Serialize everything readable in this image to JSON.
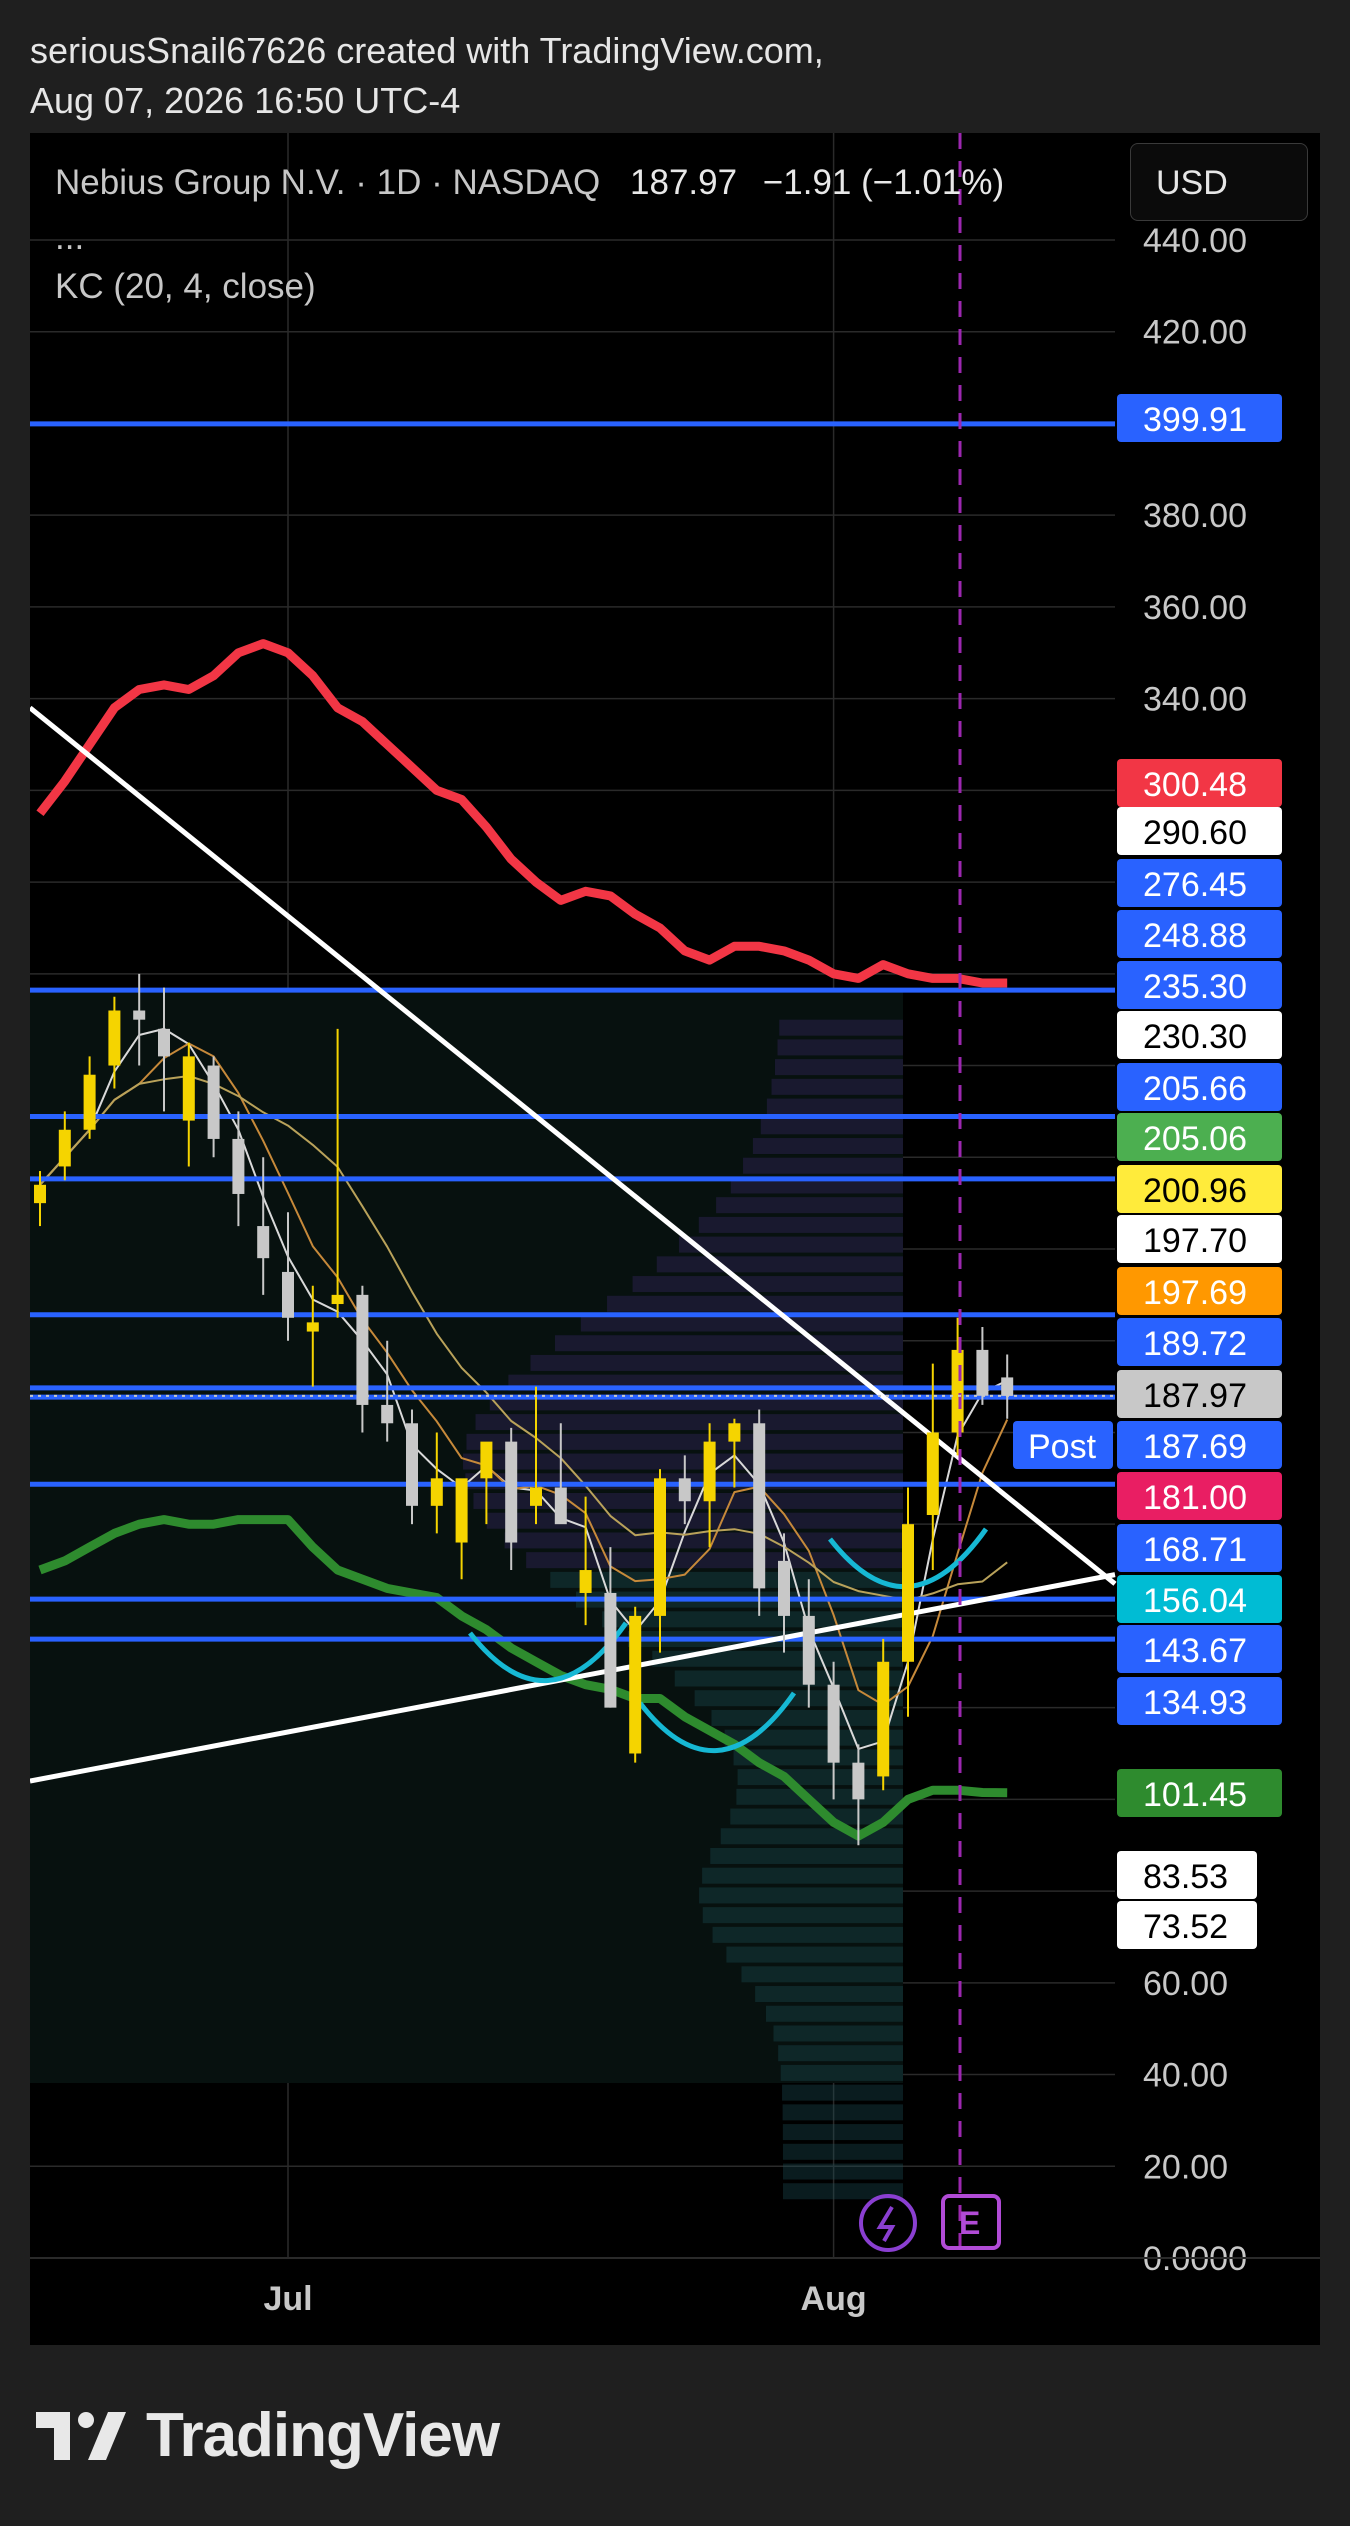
{
  "header": {
    "creator_line": "seriousSnail67626 created with TradingView.com,",
    "date_line": "Aug 07, 2026 16:50 UTC-4"
  },
  "legend": {
    "symbol_line": "Nebius Group N.V. · 1D · NASDAQ",
    "last_price": "187.97",
    "change": "−1.91 (−1.01%)",
    "ellipsis": "...",
    "indicator": "KC (20, 4, close)"
  },
  "currency_button": "USD",
  "event_marker": "E",
  "footer": {
    "brand": "TradingView"
  },
  "colors": {
    "background": "#000000",
    "grid": "#2a2a2a",
    "up_candle": "#f5d400",
    "down_candle": "#c8c8c8",
    "kc_upper": "#f23645",
    "kc_lower": "#2e8b2e",
    "horizontal_line": "#2962ff",
    "trendline": "#ffffff",
    "event_line": "#9c27b0",
    "arc": "#16b8d4"
  },
  "chart_data": {
    "type": "candlestick",
    "y_axis": {
      "min": 0,
      "max": 450,
      "ticks": [
        {
          "value": 440,
          "label": "440.00"
        },
        {
          "value": 420,
          "label": "420.00"
        },
        {
          "value": 380,
          "label": "380.00"
        },
        {
          "value": 360,
          "label": "360.00"
        },
        {
          "value": 340,
          "label": "340.00"
        },
        {
          "value": 60,
          "label": "60.00"
        },
        {
          "value": 40,
          "label": "40.00"
        },
        {
          "value": 20,
          "label": "20.00"
        },
        {
          "value": 0,
          "label": "0.0000"
        }
      ]
    },
    "x_axis": {
      "labels": [
        {
          "label": "Jul",
          "bar_index": 10
        },
        {
          "label": "Aug",
          "bar_index": 32
        }
      ]
    },
    "candles": [
      {
        "o": 230,
        "h": 237,
        "l": 225,
        "c": 234
      },
      {
        "o": 238,
        "h": 250,
        "l": 235,
        "c": 246
      },
      {
        "o": 246,
        "h": 262,
        "l": 244,
        "c": 258
      },
      {
        "o": 260,
        "h": 275,
        "l": 255,
        "c": 272
      },
      {
        "o": 272,
        "h": 280,
        "l": 260,
        "c": 270
      },
      {
        "o": 268,
        "h": 277,
        "l": 250,
        "c": 262
      },
      {
        "o": 248,
        "h": 265,
        "l": 238,
        "c": 262
      },
      {
        "o": 260,
        "h": 262,
        "l": 240,
        "c": 244
      },
      {
        "o": 244,
        "h": 250,
        "l": 225,
        "c": 232
      },
      {
        "o": 225,
        "h": 240,
        "l": 210,
        "c": 218
      },
      {
        "o": 215,
        "h": 228,
        "l": 200,
        "c": 205
      },
      {
        "o": 202,
        "h": 212,
        "l": 190,
        "c": 204
      },
      {
        "o": 208,
        "h": 268,
        "l": 205,
        "c": 210
      },
      {
        "o": 210,
        "h": 212,
        "l": 180,
        "c": 186
      },
      {
        "o": 186,
        "h": 200,
        "l": 178,
        "c": 182
      },
      {
        "o": 182,
        "h": 185,
        "l": 160,
        "c": 164
      },
      {
        "o": 164,
        "h": 180,
        "l": 158,
        "c": 170
      },
      {
        "o": 156,
        "h": 164,
        "l": 148,
        "c": 170
      },
      {
        "o": 170,
        "h": 176,
        "l": 160,
        "c": 178
      },
      {
        "o": 178,
        "h": 181,
        "l": 150,
        "c": 156
      },
      {
        "o": 164,
        "h": 190,
        "l": 160,
        "c": 168
      },
      {
        "o": 168,
        "h": 182,
        "l": 163,
        "c": 160
      },
      {
        "o": 145,
        "h": 166,
        "l": 138,
        "c": 150
      },
      {
        "o": 145,
        "h": 155,
        "l": 120,
        "c": 120
      },
      {
        "o": 110,
        "h": 142,
        "l": 108,
        "c": 140
      },
      {
        "o": 140,
        "h": 172,
        "l": 132,
        "c": 170
      },
      {
        "o": 170,
        "h": 175,
        "l": 160,
        "c": 165
      },
      {
        "o": 165,
        "h": 182,
        "l": 155,
        "c": 178
      },
      {
        "o": 178,
        "h": 183,
        "l": 168,
        "c": 182
      },
      {
        "o": 182,
        "h": 185,
        "l": 140,
        "c": 146
      },
      {
        "o": 152,
        "h": 158,
        "l": 132,
        "c": 140
      },
      {
        "o": 140,
        "h": 148,
        "l": 120,
        "c": 125
      },
      {
        "o": 125,
        "h": 130,
        "l": 100,
        "c": 108
      },
      {
        "o": 108,
        "h": 112,
        "l": 90,
        "c": 100
      },
      {
        "o": 105,
        "h": 135,
        "l": 102,
        "c": 130
      },
      {
        "o": 130,
        "h": 168,
        "l": 118,
        "c": 160
      },
      {
        "o": 162,
        "h": 195,
        "l": 150,
        "c": 180
      },
      {
        "o": 180,
        "h": 205,
        "l": 175,
        "c": 198
      },
      {
        "o": 198,
        "h": 203,
        "l": 186,
        "c": 188
      },
      {
        "o": 192,
        "h": 197,
        "l": 183,
        "c": 187.97
      }
    ],
    "keltner_channel": {
      "params": "KC (20, 4, close)",
      "upper": [
        315,
        322,
        330,
        338,
        342,
        343,
        342,
        345,
        350,
        352,
        350,
        345,
        338,
        335,
        330,
        325,
        320,
        318,
        312,
        305,
        300,
        296,
        298,
        297,
        293,
        290,
        285,
        283,
        286,
        286,
        285,
        283,
        280,
        279,
        282,
        280,
        279,
        279,
        278,
        278
      ],
      "lower": [
        150,
        152,
        155,
        158,
        160,
        161,
        160,
        160,
        161,
        161,
        161,
        155,
        150,
        148,
        146,
        145,
        144,
        140,
        137,
        133,
        130,
        127,
        125,
        124,
        122,
        122,
        118,
        115,
        112,
        108,
        105,
        100,
        95,
        92,
        95,
        100,
        102,
        102,
        101.5,
        101.45
      ]
    },
    "horizontal_levels": [
      {
        "value": 399.91,
        "label": "399.91",
        "color": "#2962ff"
      },
      {
        "value": 300.48,
        "label": "300.48",
        "color": "#f23645"
      },
      {
        "value": 290.6,
        "label": "290.60",
        "color": "#ffffff"
      },
      {
        "value": 276.45,
        "label": "276.45",
        "color": "#2962ff"
      },
      {
        "value": 248.88,
        "label": "248.88",
        "color": "#2962ff"
      },
      {
        "value": 235.3,
        "label": "235.30",
        "color": "#2962ff"
      },
      {
        "value": 230.3,
        "label": "230.30",
        "color": "#ffffff"
      },
      {
        "value": 205.66,
        "label": "205.66",
        "color": "#2962ff"
      },
      {
        "value": 205.06,
        "label": "205.06",
        "color": "#4caf50"
      },
      {
        "value": 200.96,
        "label": "200.96",
        "color": "#ffeb3b"
      },
      {
        "value": 197.7,
        "label": "197.70",
        "color": "#ffffff"
      },
      {
        "value": 197.69,
        "label": "197.69",
        "color": "#ff9800"
      },
      {
        "value": 189.72,
        "label": "189.72",
        "color": "#2962ff"
      },
      {
        "value": 187.97,
        "label": "187.97",
        "color": "#c8c8c8"
      },
      {
        "value": 187.69,
        "label": "187.69",
        "color": "#2962ff",
        "tag": "Post"
      },
      {
        "value": 181.0,
        "label": "181.00",
        "color": "#e91e63"
      },
      {
        "value": 168.71,
        "label": "168.71",
        "color": "#2962ff"
      },
      {
        "value": 156.04,
        "label": "156.04",
        "color": "#00bcd4"
      },
      {
        "value": 143.67,
        "label": "143.67",
        "color": "#2962ff"
      },
      {
        "value": 134.93,
        "label": "134.93",
        "color": "#2962ff"
      },
      {
        "value": 101.45,
        "label": "101.45",
        "color": "#2e8b2e"
      },
      {
        "value": 83.53,
        "label": "83.53",
        "color": "#ffffff"
      },
      {
        "value": 73.52,
        "label": "73.52",
        "color": "#ffffff"
      }
    ]
  }
}
